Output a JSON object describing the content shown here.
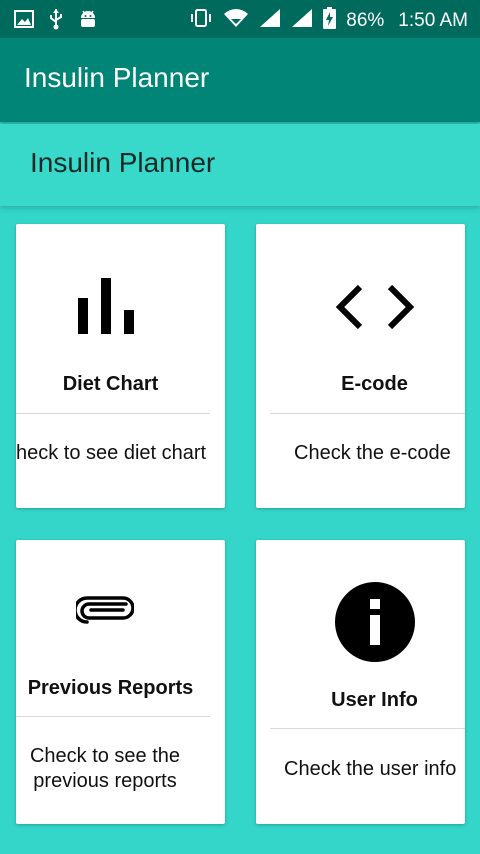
{
  "status_bar": {
    "battery": "86%",
    "time": "1:50 AM"
  },
  "app_bar": {
    "title": "Insulin Planner"
  },
  "header": {
    "title": "Insulin Planner"
  },
  "cards": [
    {
      "icon": "bar-chart-icon",
      "title": "Diet Chart",
      "desc_lines": [
        "heck to see diet chart"
      ]
    },
    {
      "icon": "code-icon",
      "title": "E-code",
      "desc_lines": [
        "Check the e-code"
      ]
    },
    {
      "icon": "paperclip-icon",
      "title": "Previous Reports",
      "desc_lines": [
        "Check to see the",
        "previous reports"
      ]
    },
    {
      "icon": "info-icon",
      "title": "User Info",
      "desc_lines": [
        "Check the user info"
      ]
    }
  ]
}
